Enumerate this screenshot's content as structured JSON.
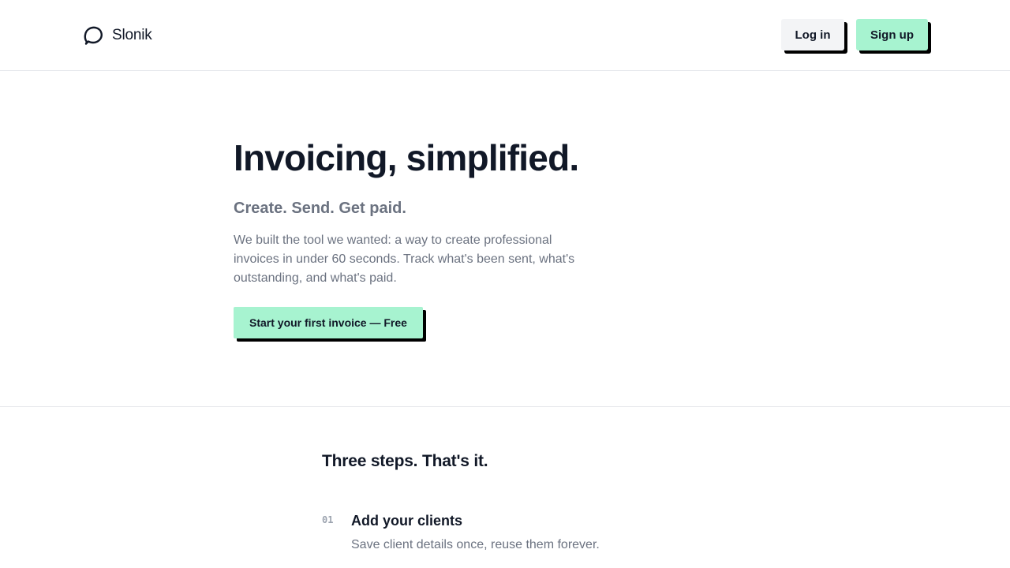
{
  "header": {
    "brand_name": "Slonik",
    "brand_icon": "speech-bubble-icon",
    "login_label": "Log in",
    "signup_label": "Sign up"
  },
  "hero": {
    "title": "Invoicing, simplified.",
    "subtitle": "Create. Send. Get paid.",
    "description": "We built the tool we wanted: a way to create professional invoices in under 60 seconds. Track what's been sent, what's outstanding, and what's paid.",
    "cta_label": "Start your first invoice — Free"
  },
  "steps": {
    "title": "Three steps. That's it.",
    "items": [
      {
        "number": "01",
        "title": "Add your clients",
        "description": "Save client details once, reuse them forever."
      }
    ]
  },
  "colors": {
    "accent": "#a7f3d0",
    "text_primary": "#111827",
    "text_muted": "#6b7280",
    "button_secondary_bg": "#f3f4f6",
    "shadow": "#000000",
    "border": "#e5e7eb"
  }
}
